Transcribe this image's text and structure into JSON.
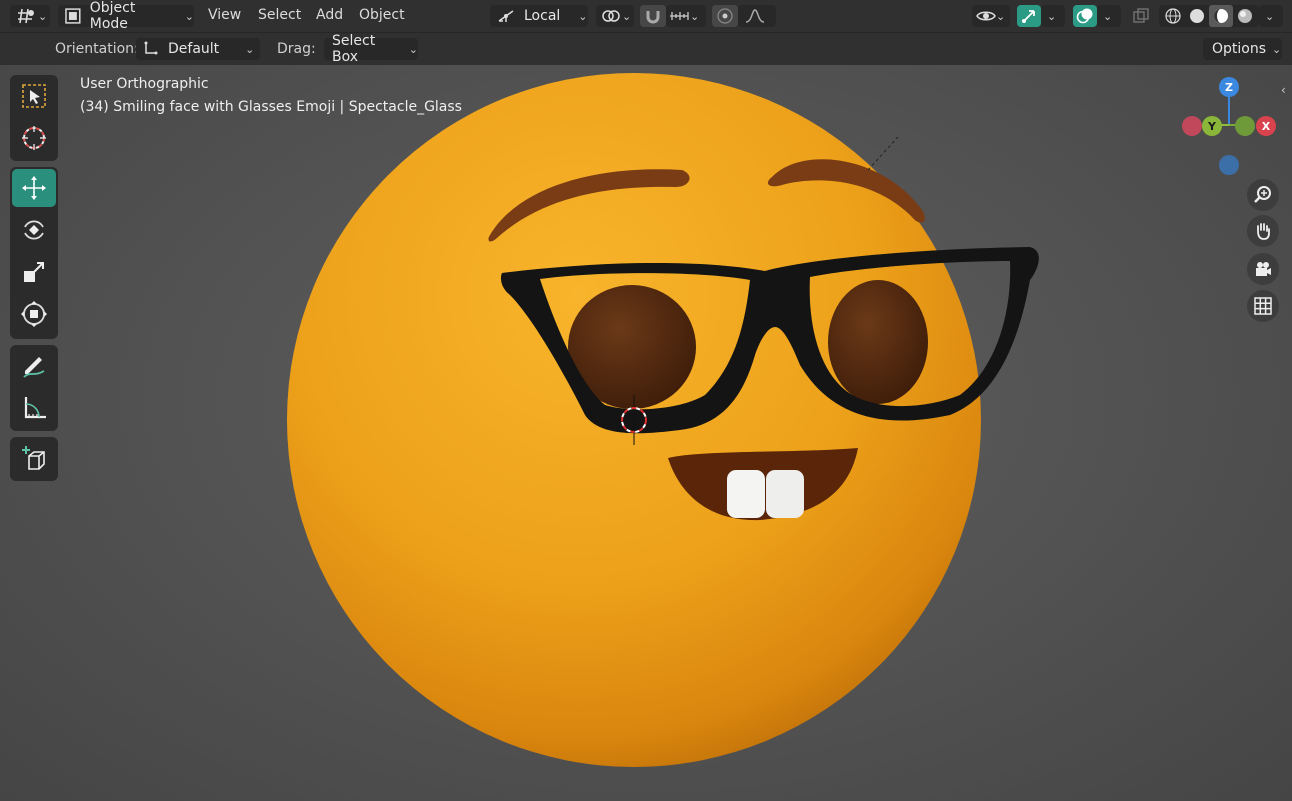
{
  "header": {
    "editor_type_icon": "viewport-grid-icon",
    "mode_label": "Object Mode",
    "menus": [
      "View",
      "Select",
      "Add",
      "Object"
    ],
    "transform_pivot_label": "Local",
    "options_label": "Options"
  },
  "tool_settings": {
    "orientation_label": "Orientation:",
    "orientation_value": "Default",
    "drag_label": "Drag:",
    "drag_value": "Select Box"
  },
  "viewport": {
    "view_name": "User Orthographic",
    "object_info": "(34) Smiling face with Glasses Emoji | Spectacle_Glass"
  },
  "gizmo": {
    "z": "Z",
    "y": "Y",
    "x": "X"
  },
  "toolbar_tools": [
    "select-box",
    "cursor",
    "move",
    "rotate",
    "scale",
    "transform",
    "annotate",
    "measure",
    "add-cube"
  ],
  "colors": {
    "active_tool": "#2a8f7d",
    "header_bg": "#303030",
    "viewport_bg": "#545454",
    "emoji_yellow": "#f2a61d"
  }
}
